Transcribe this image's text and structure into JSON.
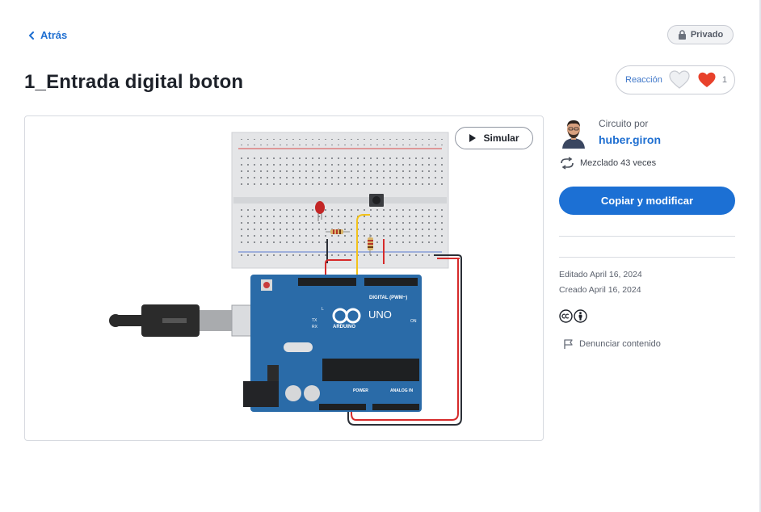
{
  "nav": {
    "back_label": "Atrás"
  },
  "badge": {
    "private_label": "Privado"
  },
  "title": "1_Entrada digital boton",
  "reactions": {
    "label": "Reacción",
    "count": "1"
  },
  "canvas": {
    "simulate_label": "Simular"
  },
  "circuit": {
    "board_uno_label": "UNO",
    "board_brand_label": "ARDUINO",
    "digital_label": "DIGITAL (PWM~)",
    "power_label": "POWER",
    "analog_label": "ANALOG IN",
    "on_label": "ON",
    "l_label": "L",
    "tx_label": "TX",
    "rx_label": "RX"
  },
  "sidebar": {
    "circuit_by_label": "Circuito por",
    "author": "huber.giron",
    "remix_text": "Mezclado 43 veces",
    "copy_button_label": "Copiar y modificar",
    "edited_text": "Editado April 16, 2024",
    "created_text": "Creado April 16, 2024",
    "report_label": "Denunciar contenido"
  },
  "icons": {
    "back": "chevron-left-icon",
    "lock": "lock-icon",
    "heart_outline": "heart-outline-icon",
    "heart_filled": "heart-filled-icon",
    "play": "play-icon",
    "remix": "remix-icon",
    "cc": "creative-commons-icon",
    "by": "attribution-icon",
    "flag": "flag-icon"
  },
  "colors": {
    "accent_blue": "#1c70d4",
    "link_blue": "#1f6fd1",
    "heart_red": "#e8412b",
    "board_blue": "#2a6ba8",
    "wire_red": "#d62b2b",
    "wire_yellow": "#f2c21a",
    "wire_black": "#2b2f36"
  }
}
